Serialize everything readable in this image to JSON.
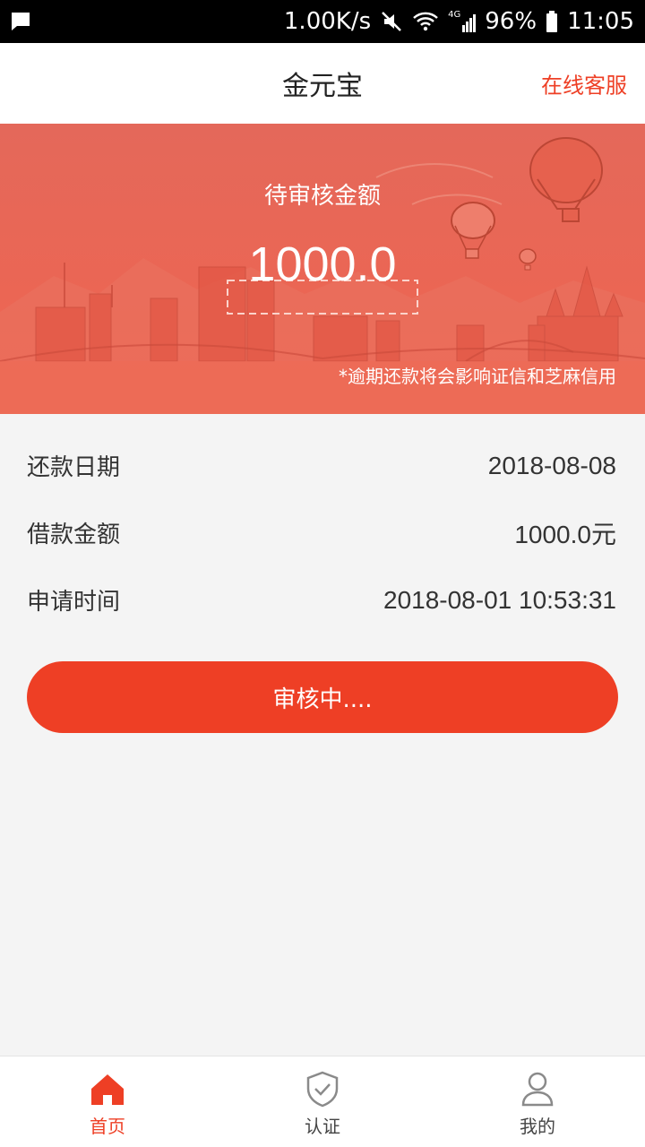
{
  "status_bar": {
    "net_speed": "1.00K/s",
    "network": "4G",
    "battery": "96%",
    "time": "11:05"
  },
  "header": {
    "title": "金元宝",
    "service_link": "在线客服"
  },
  "banner": {
    "label": "待审核金额",
    "amount": "1000.0",
    "notice": "*逾期还款将会影响证信和芝麻信用"
  },
  "details": [
    {
      "label": "还款日期",
      "value": "2018-08-08"
    },
    {
      "label": "借款金额",
      "value": "1000.0元"
    },
    {
      "label": "申请时间",
      "value": "2018-08-01 10:53:31"
    }
  ],
  "status_button": "审核中....",
  "bottom_nav": [
    {
      "label": "首页",
      "icon": "home-icon",
      "active": true
    },
    {
      "label": "认证",
      "icon": "shield-check-icon",
      "active": false
    },
    {
      "label": "我的",
      "icon": "user-icon",
      "active": false
    }
  ],
  "colors": {
    "accent": "#ee3f25",
    "banner": "#ea5f4c"
  }
}
